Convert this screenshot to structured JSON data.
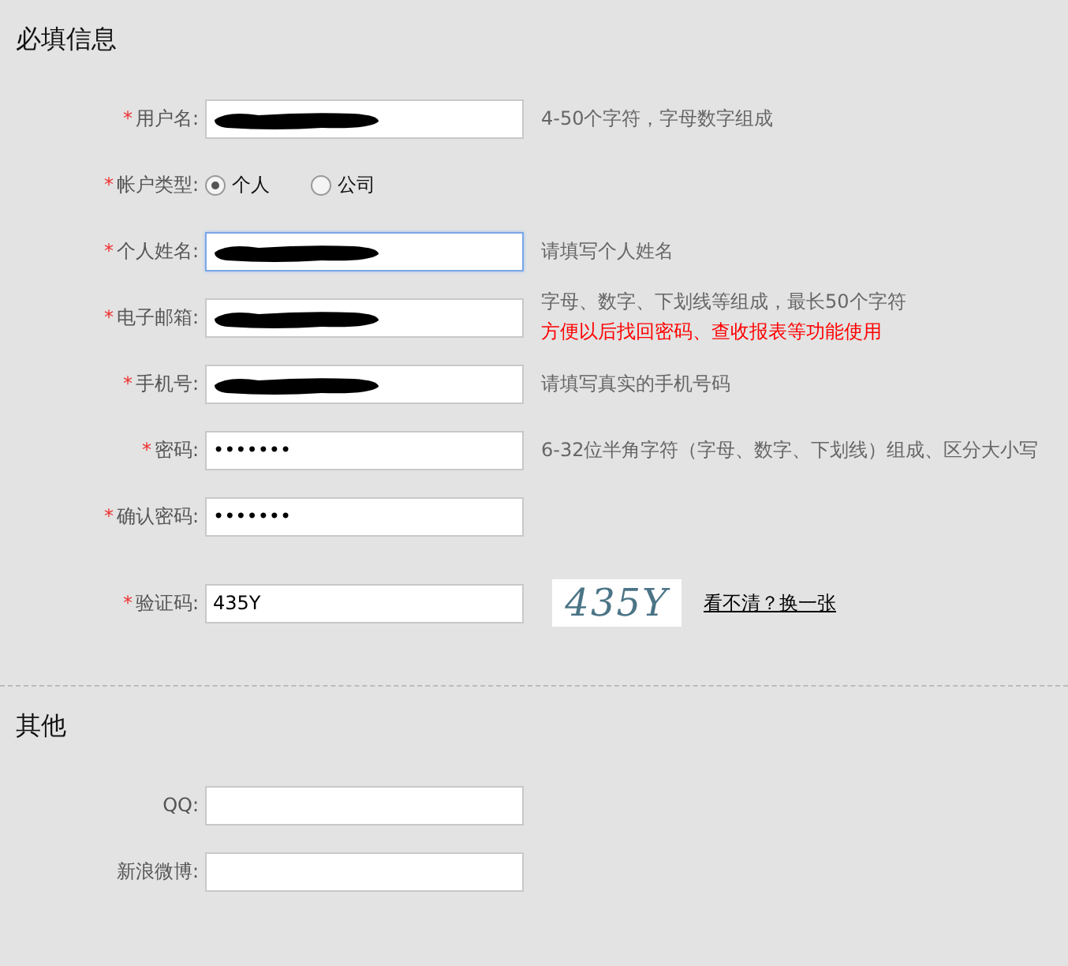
{
  "sections": [
    {
      "title": "必填信息",
      "fields": [
        {
          "kind": "text",
          "marker": "*",
          "label": "用户名:",
          "redacted": true,
          "focused": false,
          "hints": [
            {
              "text": "4-50个字符，字母数字组成",
              "warning": false
            }
          ]
        },
        {
          "kind": "radio",
          "marker": "*",
          "label": "帐户类型:",
          "options": [
            {
              "label": "个人",
              "selected": true
            },
            {
              "label": "公司",
              "selected": false
            }
          ]
        },
        {
          "kind": "text",
          "marker": "*",
          "label": "个人姓名:",
          "redacted": true,
          "focused": true,
          "hints": [
            {
              "text": "请填写个人姓名",
              "warning": false
            }
          ]
        },
        {
          "kind": "text",
          "marker": "*",
          "label": "电子邮箱:",
          "redacted": true,
          "focused": false,
          "hints": [
            {
              "text": "字母、数字、下划线等组成，最长50个字符",
              "warning": false
            },
            {
              "text": "方便以后找回密码、查收报表等功能使用",
              "warning": true
            }
          ]
        },
        {
          "kind": "text",
          "marker": "*",
          "label": "手机号:",
          "redacted": true,
          "focused": false,
          "hints": [
            {
              "text": "请填写真实的手机号码",
              "warning": false
            }
          ]
        },
        {
          "kind": "text",
          "marker": "*",
          "label": "密码:",
          "value": "•••••••",
          "focused": false,
          "hints": [
            {
              "text": "6-32位半角字符（字母、数字、下划线）组成、区分大小写",
              "warning": false
            }
          ]
        },
        {
          "kind": "text",
          "marker": "*",
          "label": "确认密码:",
          "value": "•••••••",
          "focused": false
        },
        {
          "kind": "captcha",
          "marker": "*",
          "label": "验证码:",
          "value": "435Y",
          "captcha": "435Y",
          "link": "看不清？换一张"
        }
      ]
    },
    {
      "title": "其他",
      "fields": [
        {
          "kind": "text",
          "label": "QQ:",
          "focused": false
        },
        {
          "kind": "text",
          "label": "新浪微博:",
          "focused": false
        }
      ]
    }
  ]
}
